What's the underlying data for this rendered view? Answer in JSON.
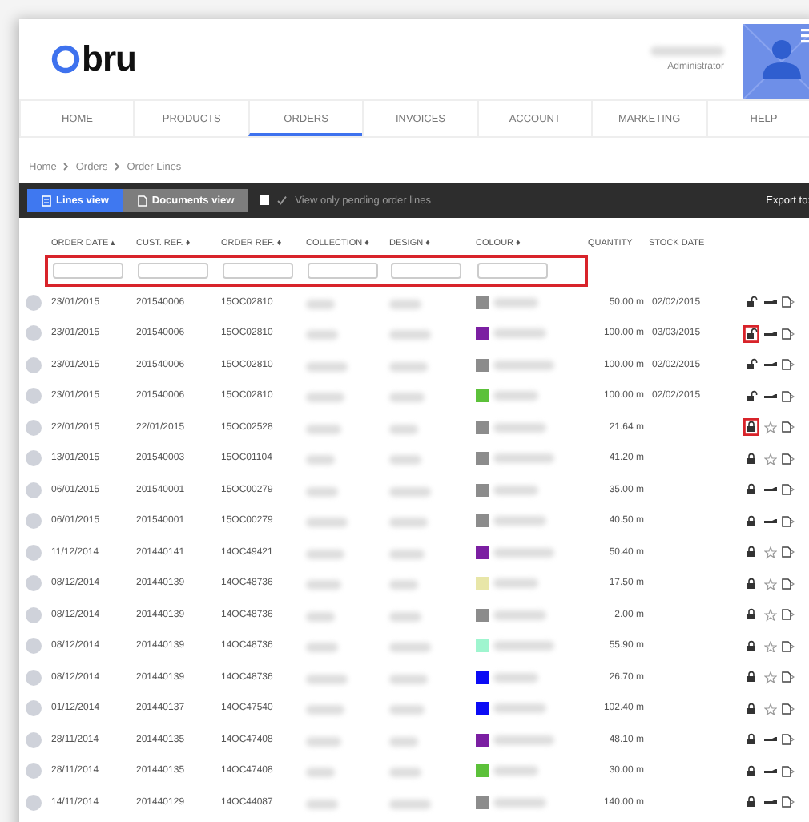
{
  "header": {
    "logo_text": "bru",
    "user_role": "Administrator"
  },
  "nav": [
    {
      "label": "HOME",
      "selected": false
    },
    {
      "label": "PRODUCTS",
      "selected": false
    },
    {
      "label": "ORDERS",
      "selected": true
    },
    {
      "label": "INVOICES",
      "selected": false
    },
    {
      "label": "ACCOUNT",
      "selected": false
    },
    {
      "label": "MARKETING",
      "selected": false
    },
    {
      "label": "HELP",
      "selected": false
    }
  ],
  "breadcrumb": [
    "Home",
    "Orders",
    "Order Lines"
  ],
  "toolbar": {
    "views": [
      {
        "label": "Lines view",
        "selected": true
      },
      {
        "label": "Documents view",
        "selected": false
      }
    ],
    "pending_filter": {
      "label": "View only pending order lines",
      "checked": false
    },
    "export_label": "Export to:"
  },
  "table": {
    "columns": [
      "ORDER DATE ▴",
      "CUST. REF. ♦",
      "ORDER REF. ♦",
      "COLLECTION ♦",
      "DESIGN ♦",
      "COLOUR ♦",
      "QUANTITY",
      "STOCK DATE"
    ],
    "filters_highlighted": true,
    "rows": [
      {
        "order_date": "23/01/2015",
        "cust_ref": "201540006",
        "order_ref": "15OC02810",
        "color": "#8c8c8c",
        "quantity": "50.00 m",
        "stock_date": "02/02/2015",
        "locked": false,
        "lock_highlighted": false,
        "kind": "truck"
      },
      {
        "order_date": "23/01/2015",
        "cust_ref": "201540006",
        "order_ref": "15OC02810",
        "color": "#7b1fa2",
        "quantity": "100.00 m",
        "stock_date": "03/03/2015",
        "locked": false,
        "lock_highlighted": true,
        "kind": "truck"
      },
      {
        "order_date": "23/01/2015",
        "cust_ref": "201540006",
        "order_ref": "15OC02810",
        "color": "#8c8c8c",
        "quantity": "100.00 m",
        "stock_date": "02/02/2015",
        "locked": false,
        "lock_highlighted": false,
        "kind": "truck"
      },
      {
        "order_date": "23/01/2015",
        "cust_ref": "201540006",
        "order_ref": "15OC02810",
        "color": "#5cc13a",
        "quantity": "100.00 m",
        "stock_date": "02/02/2015",
        "locked": false,
        "lock_highlighted": false,
        "kind": "truck"
      },
      {
        "order_date": "22/01/2015",
        "cust_ref": "22/01/2015",
        "order_ref": "15OC02528",
        "color": "#8c8c8c",
        "quantity": "21.64 m",
        "locked": true,
        "lock_highlighted": true,
        "kind": "star"
      },
      {
        "order_date": "13/01/2015",
        "cust_ref": "201540003",
        "order_ref": "15OC01104",
        "color": "#8c8c8c",
        "quantity": "41.20 m",
        "locked": true,
        "lock_highlighted": false,
        "kind": "star"
      },
      {
        "order_date": "06/01/2015",
        "cust_ref": "201540001",
        "order_ref": "15OC00279",
        "color": "#8c8c8c",
        "quantity": "35.00 m",
        "locked": true,
        "lock_highlighted": false,
        "kind": "truck"
      },
      {
        "order_date": "06/01/2015",
        "cust_ref": "201540001",
        "order_ref": "15OC00279",
        "color": "#8c8c8c",
        "quantity": "40.50 m",
        "locked": true,
        "lock_highlighted": false,
        "kind": "truck"
      },
      {
        "order_date": "11/12/2014",
        "cust_ref": "201440141",
        "order_ref": "14OC49421",
        "color": "#7b1fa2",
        "quantity": "50.40 m",
        "locked": true,
        "lock_highlighted": false,
        "kind": "star"
      },
      {
        "order_date": "08/12/2014",
        "cust_ref": "201440139",
        "order_ref": "14OC48736",
        "color": "#e8e6a8",
        "quantity": "17.50 m",
        "locked": true,
        "lock_highlighted": false,
        "kind": "star"
      },
      {
        "order_date": "08/12/2014",
        "cust_ref": "201440139",
        "order_ref": "14OC48736",
        "color": "#8c8c8c",
        "quantity": "2.00 m",
        "locked": true,
        "lock_highlighted": false,
        "kind": "star"
      },
      {
        "order_date": "08/12/2014",
        "cust_ref": "201440139",
        "order_ref": "14OC48736",
        "color": "#9ff5cf",
        "quantity": "55.90 m",
        "locked": true,
        "lock_highlighted": false,
        "kind": "star"
      },
      {
        "order_date": "08/12/2014",
        "cust_ref": "201440139",
        "order_ref": "14OC48736",
        "color": "#0b0bf5",
        "quantity": "26.70 m",
        "locked": true,
        "lock_highlighted": false,
        "kind": "star"
      },
      {
        "order_date": "01/12/2014",
        "cust_ref": "201440137",
        "order_ref": "14OC47540",
        "color": "#0b0bf5",
        "quantity": "102.40 m",
        "locked": true,
        "lock_highlighted": false,
        "kind": "star"
      },
      {
        "order_date": "28/11/2014",
        "cust_ref": "201440135",
        "order_ref": "14OC47408",
        "color": "#7b1fa2",
        "quantity": "48.10 m",
        "locked": true,
        "lock_highlighted": false,
        "kind": "truck"
      },
      {
        "order_date": "28/11/2014",
        "cust_ref": "201440135",
        "order_ref": "14OC47408",
        "color": "#5cc13a",
        "quantity": "30.00 m",
        "locked": true,
        "lock_highlighted": false,
        "kind": "truck"
      },
      {
        "order_date": "14/11/2014",
        "cust_ref": "201440129",
        "order_ref": "14OC44087",
        "color": "#8c8c8c",
        "quantity": "140.00 m",
        "locked": true,
        "lock_highlighted": false,
        "kind": "truck"
      }
    ]
  }
}
